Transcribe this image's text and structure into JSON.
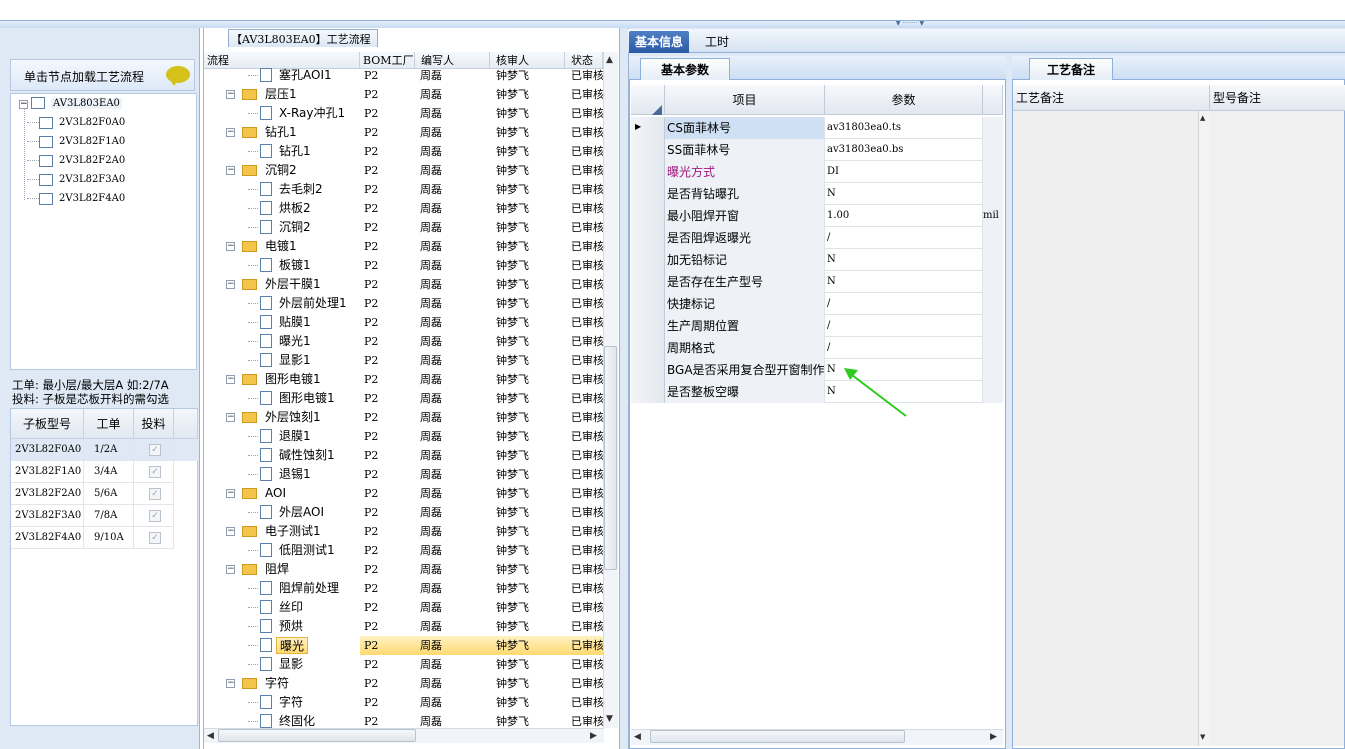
{
  "left": {
    "load_button": "单击节点加载工艺流程",
    "tree_root": "AV3L803EA0",
    "tree_children": [
      "2V3L82F0A0",
      "2V3L82F1A0",
      "2V3L82F2A0",
      "2V3L82F3A0",
      "2V3L82F4A0"
    ],
    "info_line1": "工单: 最小层/最大层A 如:2/7A",
    "info_line2": "投料: 子板是芯板开料的需勾选",
    "table_headers": [
      "子板型号",
      "工单",
      "投料"
    ],
    "table_rows": [
      {
        "model": "2V3L82F0A0",
        "order": "1/2A",
        "feed": "✓"
      },
      {
        "model": "2V3L82F1A0",
        "order": "3/4A",
        "feed": "✓"
      },
      {
        "model": "2V3L82F2A0",
        "order": "5/6A",
        "feed": "✓"
      },
      {
        "model": "2V3L82F3A0",
        "order": "7/8A",
        "feed": "✓"
      },
      {
        "model": "2V3L82F4A0",
        "order": "9/10A",
        "feed": "✓"
      }
    ]
  },
  "process": {
    "title": "【AV3L803EA0】工艺流程",
    "headers": [
      "流程",
      "BOM工厂",
      "编写人",
      "核审人",
      "状态"
    ],
    "rows": [
      {
        "name": "塞孔AOI1",
        "bom": "P2",
        "writer": "周磊",
        "reviewer": "钟梦飞",
        "status": "已审核"
      },
      {
        "name": "层压1",
        "bom": "P2",
        "writer": "周磊",
        "reviewer": "钟梦飞",
        "status": "已审核"
      },
      {
        "name": "X-Ray冲孔1",
        "bom": "P2",
        "writer": "周磊",
        "reviewer": "钟梦飞",
        "status": "已审核"
      },
      {
        "name": "钻孔1",
        "bom": "P2",
        "writer": "周磊",
        "reviewer": "钟梦飞",
        "status": "已审核"
      },
      {
        "name": "钻孔1",
        "bom": "P2",
        "writer": "周磊",
        "reviewer": "钟梦飞",
        "status": "已审核"
      },
      {
        "name": "沉铜2",
        "bom": "P2",
        "writer": "周磊",
        "reviewer": "钟梦飞",
        "status": "已审核"
      },
      {
        "name": "去毛刺2",
        "bom": "P2",
        "writer": "周磊",
        "reviewer": "钟梦飞",
        "status": "已审核"
      },
      {
        "name": "烘板2",
        "bom": "P2",
        "writer": "周磊",
        "reviewer": "钟梦飞",
        "status": "已审核"
      },
      {
        "name": "沉铜2",
        "bom": "P2",
        "writer": "周磊",
        "reviewer": "钟梦飞",
        "status": "已审核"
      },
      {
        "name": "电镀1",
        "bom": "P2",
        "writer": "周磊",
        "reviewer": "钟梦飞",
        "status": "已审核"
      },
      {
        "name": "板镀1",
        "bom": "P2",
        "writer": "周磊",
        "reviewer": "钟梦飞",
        "status": "已审核"
      },
      {
        "name": "外层干膜1",
        "bom": "P2",
        "writer": "周磊",
        "reviewer": "钟梦飞",
        "status": "已审核"
      },
      {
        "name": "外层前处理1",
        "bom": "P2",
        "writer": "周磊",
        "reviewer": "钟梦飞",
        "status": "已审核"
      },
      {
        "name": "贴膜1",
        "bom": "P2",
        "writer": "周磊",
        "reviewer": "钟梦飞",
        "status": "已审核"
      },
      {
        "name": "曝光1",
        "bom": "P2",
        "writer": "周磊",
        "reviewer": "钟梦飞",
        "status": "已审核"
      },
      {
        "name": "显影1",
        "bom": "P2",
        "writer": "周磊",
        "reviewer": "钟梦飞",
        "status": "已审核"
      },
      {
        "name": "图形电镀1",
        "bom": "P2",
        "writer": "周磊",
        "reviewer": "钟梦飞",
        "status": "已审核"
      },
      {
        "name": "图形电镀1",
        "bom": "P2",
        "writer": "周磊",
        "reviewer": "钟梦飞",
        "status": "已审核"
      },
      {
        "name": "外层蚀刻1",
        "bom": "P2",
        "writer": "周磊",
        "reviewer": "钟梦飞",
        "status": "已审核"
      },
      {
        "name": "退膜1",
        "bom": "P2",
        "writer": "周磊",
        "reviewer": "钟梦飞",
        "status": "已审核"
      },
      {
        "name": "碱性蚀刻1",
        "bom": "P2",
        "writer": "周磊",
        "reviewer": "钟梦飞",
        "status": "已审核"
      },
      {
        "name": "退锡1",
        "bom": "P2",
        "writer": "周磊",
        "reviewer": "钟梦飞",
        "status": "已审核"
      },
      {
        "name": "AOI",
        "bom": "P2",
        "writer": "周磊",
        "reviewer": "钟梦飞",
        "status": "已审核"
      },
      {
        "name": "外层AOI",
        "bom": "P2",
        "writer": "周磊",
        "reviewer": "钟梦飞",
        "status": "已审核"
      },
      {
        "name": "电子测试1",
        "bom": "P2",
        "writer": "周磊",
        "reviewer": "钟梦飞",
        "status": "已审核"
      },
      {
        "name": "低阻测试1",
        "bom": "P2",
        "writer": "周磊",
        "reviewer": "钟梦飞",
        "status": "已审核"
      },
      {
        "name": "阻焊",
        "bom": "P2",
        "writer": "周磊",
        "reviewer": "钟梦飞",
        "status": "已审核"
      },
      {
        "name": "阻焊前处理",
        "bom": "P2",
        "writer": "周磊",
        "reviewer": "钟梦飞",
        "status": "已审核"
      },
      {
        "name": "丝印",
        "bom": "P2",
        "writer": "周磊",
        "reviewer": "钟梦飞",
        "status": "已审核"
      },
      {
        "name": "预烘",
        "bom": "P2",
        "writer": "周磊",
        "reviewer": "钟梦飞",
        "status": "已审核"
      },
      {
        "name": "曝光",
        "bom": "P2",
        "writer": "周磊",
        "reviewer": "钟梦飞",
        "status": "已审核"
      },
      {
        "name": "显影",
        "bom": "P2",
        "writer": "周磊",
        "reviewer": "钟梦飞",
        "status": "已审核"
      },
      {
        "name": "字符",
        "bom": "P2",
        "writer": "周磊",
        "reviewer": "钟梦飞",
        "status": "已审核"
      },
      {
        "name": "字符",
        "bom": "P2",
        "writer": "周磊",
        "reviewer": "钟梦飞",
        "status": "已审核"
      },
      {
        "name": "终固化",
        "bom": "P2",
        "writer": "周磊",
        "reviewer": "钟梦飞",
        "status": "已审核"
      }
    ]
  },
  "right": {
    "tabs": [
      "基本信息",
      "工时"
    ],
    "basic_tab": "基本参数",
    "grid_headers": [
      "项目",
      "参数"
    ],
    "grid_rows": [
      {
        "item": "CS面菲林号",
        "value": "av31803ea0.ts",
        "unit": "",
        "color": "#000000"
      },
      {
        "item": "SS面菲林号",
        "value": "av31803ea0.bs",
        "unit": "",
        "color": "#000000"
      },
      {
        "item": "曝光方式",
        "value": "DI",
        "unit": "",
        "color": "#a0177f"
      },
      {
        "item": "是否背钻曝孔",
        "value": "N",
        "unit": "",
        "color": "#000000"
      },
      {
        "item": "最小阻焊开窗",
        "value": "1.00",
        "unit": "mil",
        "color": "#000000"
      },
      {
        "item": "是否阻焊返曝光",
        "value": "/",
        "unit": "",
        "color": "#000000"
      },
      {
        "item": "加无铅标记",
        "value": "N",
        "unit": "",
        "color": "#000000"
      },
      {
        "item": "是否存在生产型号",
        "value": "N",
        "unit": "",
        "color": "#000000"
      },
      {
        "item": "快捷标记",
        "value": "/",
        "unit": "",
        "color": "#000000"
      },
      {
        "item": "生产周期位置",
        "value": "/",
        "unit": "",
        "color": "#000000"
      },
      {
        "item": "周期格式",
        "value": "/",
        "unit": "",
        "color": "#000000"
      },
      {
        "item": "BGA是否采用复合型开窗制作",
        "value": "N",
        "unit": "",
        "color": "#000000"
      },
      {
        "item": "是否整板空曝",
        "value": "N",
        "unit": "",
        "color": "#000000"
      }
    ],
    "notes_tab": "工艺备注",
    "notes_headers": [
      "工艺备注",
      "型号备注"
    ]
  },
  "colors": {
    "accent": "#2a5aa5",
    "selection": "#ffd970",
    "annotation_arrow": "#2ecc1f"
  }
}
